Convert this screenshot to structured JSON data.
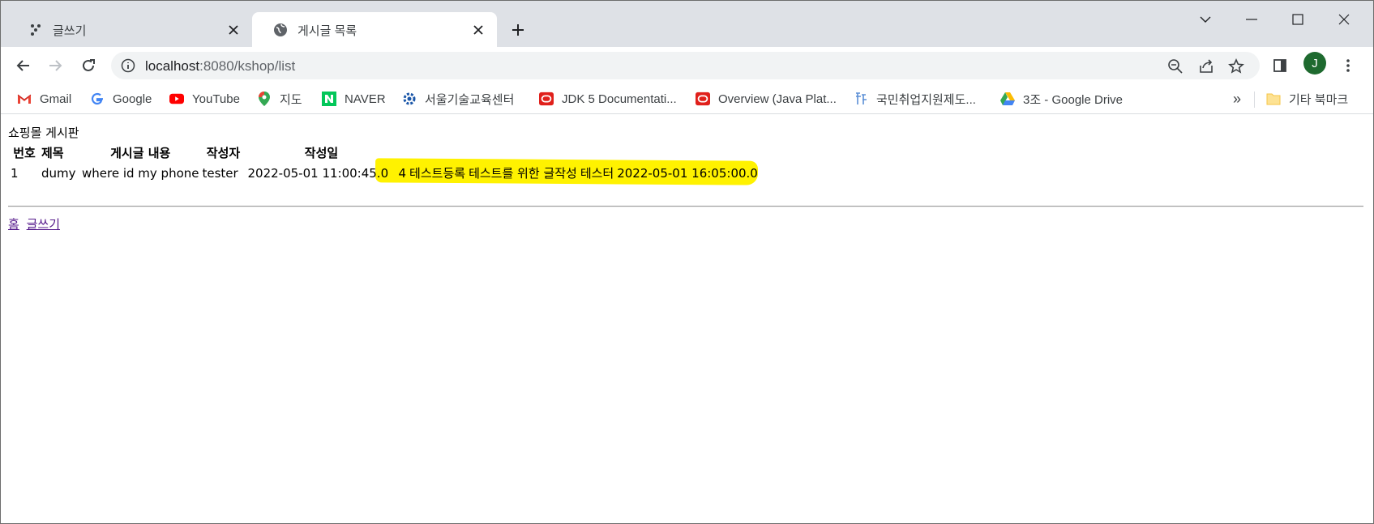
{
  "tabs": [
    {
      "title": "글쓰기",
      "active": false
    },
    {
      "title": "게시글 목록",
      "active": true
    }
  ],
  "address_bar": {
    "host": "localhost",
    "rest": ":8080/kshop/list"
  },
  "profile": {
    "initial": "J",
    "color": "#1e6a2f"
  },
  "bookmarks": [
    {
      "label": "Gmail",
      "icon": "gmail-icon"
    },
    {
      "label": "Google",
      "icon": "google-icon"
    },
    {
      "label": "YouTube",
      "icon": "youtube-icon"
    },
    {
      "label": "지도",
      "icon": "maps-icon"
    },
    {
      "label": "NAVER",
      "icon": "naver-icon"
    },
    {
      "label": "서울기술교육센터",
      "icon": "gear-icon"
    },
    {
      "label": "JDK 5 Documentati...",
      "icon": "oracle-icon"
    },
    {
      "label": "Overview (Java Plat...",
      "icon": "oracle-icon"
    },
    {
      "label": "국민취업지원제도...",
      "icon": "employment-icon"
    },
    {
      "label": "3조 - Google Drive",
      "icon": "drive-icon"
    }
  ],
  "bookmarks_overflow": "»",
  "other_bookmarks": "기타 북마크",
  "page": {
    "title": "쇼핑몰 게시판",
    "columns": [
      "번호",
      "제목",
      "게시글 내용",
      "작성자",
      "작성일"
    ],
    "rows": [
      {
        "no": "1",
        "title": "dumy",
        "content": "where id my phone",
        "writer": "tester",
        "date": "2022-05-01 11:00:45.0"
      },
      {
        "no": "4",
        "title": "테스트등록",
        "content": "테스트를 위한 글작성",
        "writer": "테스터",
        "date": "2022-05-01 16:05:00.0"
      }
    ],
    "links": [
      "홈",
      "글쓰기"
    ]
  },
  "colors": {
    "highlight": "#fff200",
    "tabstrip": "#dee1e6",
    "link": "#551a8b"
  }
}
